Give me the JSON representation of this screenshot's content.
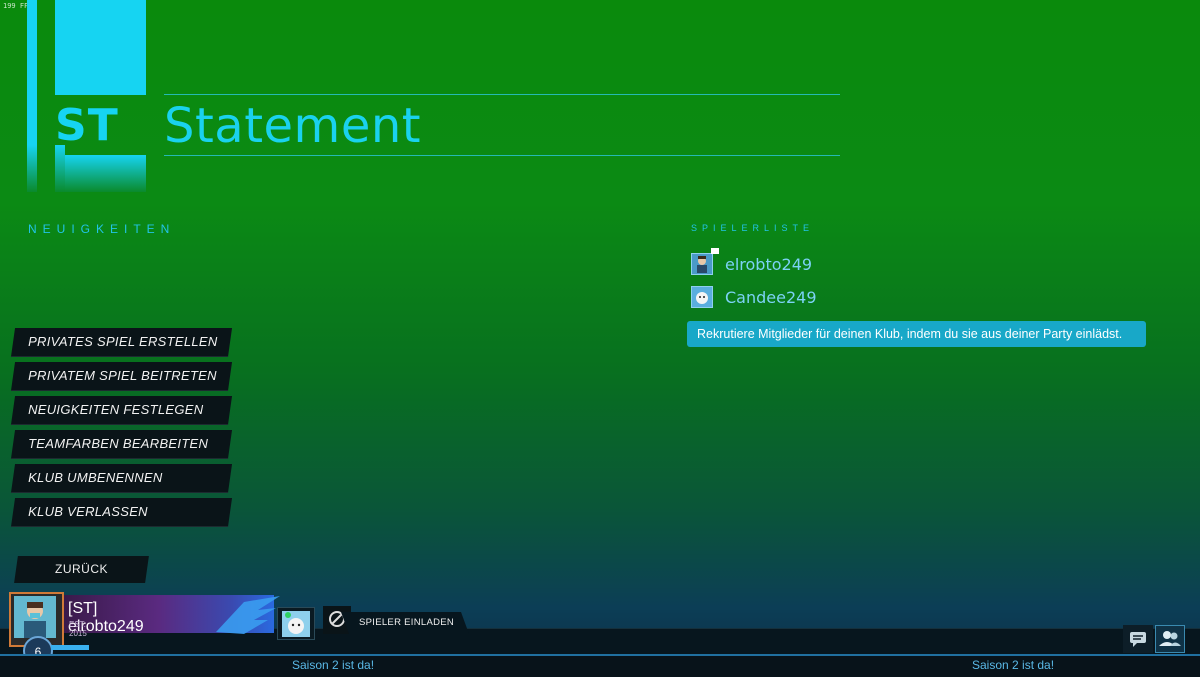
{
  "fps": "199 FPS",
  "club": {
    "tag": "ST",
    "name": "Statement"
  },
  "news": {
    "title": "NEUIGKEITEN"
  },
  "menu": {
    "items": [
      {
        "label": "PRIVATES SPIEL ERSTELLEN"
      },
      {
        "label": "PRIVATEM SPIEL BEITRETEN"
      },
      {
        "label": "NEUIGKEITEN FESTLEGEN"
      },
      {
        "label": "TEAMFARBEN BEARBEITEN"
      },
      {
        "label": "KLUB UMBENENNEN"
      },
      {
        "label": "KLUB VERLASSEN"
      }
    ],
    "back_label": "ZURÜCK"
  },
  "roster": {
    "title": "SPIELERLISTE",
    "players": [
      {
        "name": "elrobto249"
      },
      {
        "name": "Candee249"
      }
    ],
    "tooltip": "Rekrutiere Mitglieder für deinen Klub, indem du sie aus deiner Party einlädst."
  },
  "profile": {
    "title": "[ST] elrobto249",
    "established": "EST. 2015",
    "level": "6",
    "xp_fraction": 0.65
  },
  "party": {
    "invite_label": "SPIELER EINLADEN"
  },
  "ticker": {
    "left": "Saison 2 ist da!",
    "right": "Saison 2 ist da!"
  },
  "colors": {
    "accent": "#16d4f2",
    "tooltip": "#18a8c8",
    "menu_bg": "#0a1418"
  },
  "icons": {
    "chat": "chat-icon",
    "friends": "friends-icon",
    "blocked": "blocked-icon"
  }
}
